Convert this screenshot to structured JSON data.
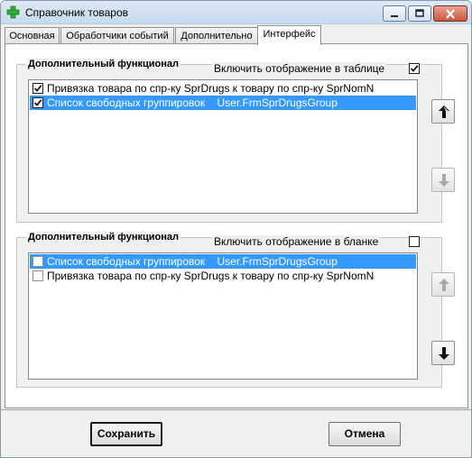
{
  "window": {
    "title": "Справочник товаров"
  },
  "tabs": [
    {
      "label": "Основная"
    },
    {
      "label": "Обработчики событий"
    },
    {
      "label": "Дополнительно"
    },
    {
      "label": "Интерфейс",
      "active": true
    }
  ],
  "table_group": {
    "title": "Дополнительный функционал",
    "toggle_label": "Включить отображение в таблице",
    "toggle_checked": true,
    "items": [
      {
        "label": "Привязка товара по спр-ку SprDrugs к товару по спр-ку SprNomN",
        "checked": true,
        "selected": false
      },
      {
        "label": "Список свободных группировок    User.FrmSprDrugsGroup",
        "checked": true,
        "selected": true
      }
    ],
    "up_enabled": true,
    "down_enabled": false
  },
  "form_group": {
    "title": "Дополнительный функционал",
    "toggle_label": "Включить отображение в бланке",
    "toggle_checked": false,
    "items": [
      {
        "label": "Список свободных группировок    User.FrmSprDrugsGroup",
        "checked": false,
        "selected": true
      },
      {
        "label": "Привязка товара по спр-ку SprDrugs к товару по спр-ку SprNomN",
        "checked": false,
        "selected": false
      }
    ],
    "up_enabled": false,
    "down_enabled": true
  },
  "footer": {
    "save_label": "Сохранить",
    "cancel_label": "Отмена"
  },
  "colors": {
    "selection": "#3399ff",
    "app_icon": "#2fae3a"
  },
  "icons": {
    "app": "green-plus-icon",
    "minimize": "minimize-icon",
    "maximize": "maximize-icon",
    "close": "close-icon",
    "up": "arrow-up-icon",
    "down": "arrow-down-icon",
    "check": "checkmark-icon"
  }
}
